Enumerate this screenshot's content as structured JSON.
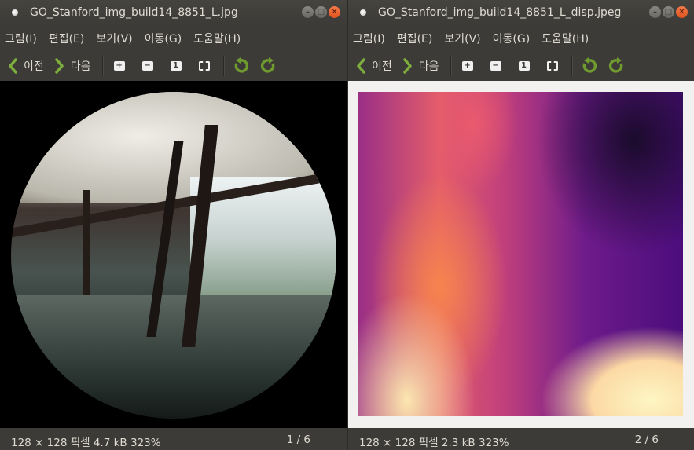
{
  "windows": [
    {
      "title": "GO_Stanford_img_build14_8851_L.jpg",
      "menu": [
        "그림(I)",
        "편집(E)",
        "보기(V)",
        "이동(G)",
        "도움말(H)"
      ],
      "toolbar": {
        "prev_label": "이전",
        "next_label": "다음"
      },
      "status": {
        "info": "128 × 128 픽셀  4.7 kB   323%",
        "page": "1 / 6"
      }
    },
    {
      "title": "GO_Stanford_img_build14_8851_L_disp.jpeg",
      "menu": [
        "그림(I)",
        "편집(E)",
        "보기(V)",
        "이동(G)",
        "도움말(H)"
      ],
      "toolbar": {
        "prev_label": "이전",
        "next_label": "다음"
      },
      "status": {
        "info": "128 × 128 픽셀  2.3 kB   323%",
        "page": "2 / 6"
      }
    }
  ],
  "colors": {
    "titlebar": "#3c3b37",
    "close_button": "#e0531d",
    "nav_arrow": "#7dae3d",
    "rotate_arrow": "#6f9a2e"
  },
  "icons": {
    "nav_prev": "chevron-left-icon",
    "nav_next": "chevron-right-icon",
    "zoom_in": "zoom-in-icon",
    "zoom_out": "zoom-out-icon",
    "normal_size": "normal-size-icon",
    "best_fit": "best-fit-icon",
    "rotate_left": "rotate-left-icon",
    "rotate_right": "rotate-right-icon"
  }
}
